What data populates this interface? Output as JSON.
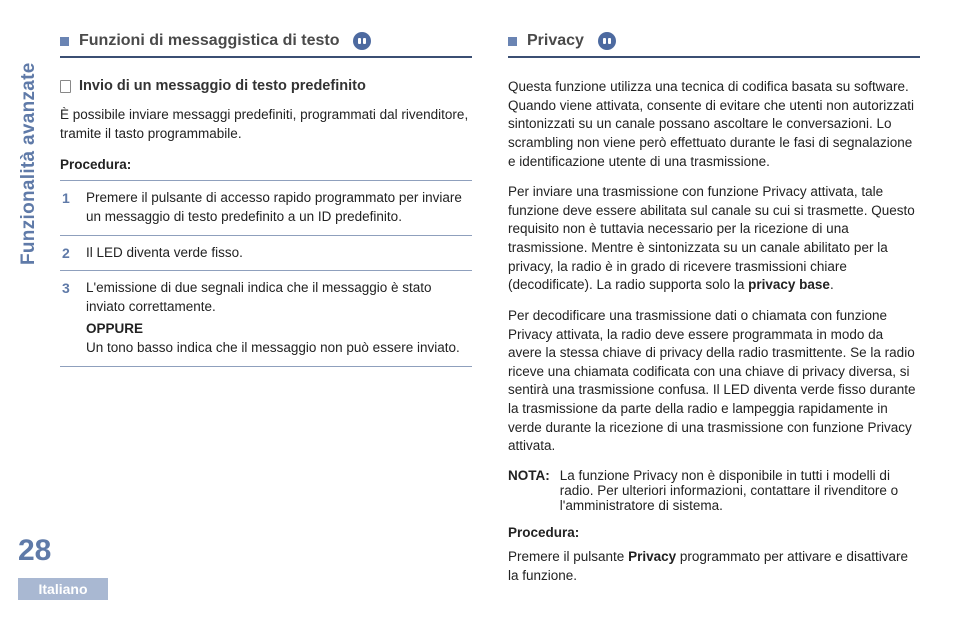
{
  "meta": {
    "side_label": "Funzionalità avanzate",
    "page_number": "28",
    "language": "Italiano"
  },
  "left": {
    "section_title": "Funzioni di messaggistica di testo",
    "sub_title": "Invio di un messaggio di testo predefinito",
    "intro": "È possibile inviare messaggi predefiniti, programmati dal rivenditore, tramite il tasto programmabile.",
    "procedure_label": "Procedura:",
    "steps": {
      "s1": "Premere il pulsante di accesso rapido programmato per inviare un messaggio di testo predefinito a un ID predefinito.",
      "s2": "Il LED diventa verde fisso.",
      "s3a": "L'emissione di due segnali indica che il messaggio è stato inviato correttamente.",
      "s3_or": "OPPURE",
      "s3b": "Un tono basso indica che il messaggio non può essere inviato."
    }
  },
  "right": {
    "section_title": "Privacy",
    "p1a": "Questa funzione utilizza una tecnica di codifica basata su software. Quando viene attivata, consente di evitare che utenti non autorizzati sintonizzati su un canale possano ascoltare le conversazioni. Lo scrambling non viene però effettuato durante le fasi di segnalazione e identificazione utente di una trasmissione.",
    "p2a": "Per inviare una trasmissione con funzione Privacy attivata, tale funzione deve essere abilitata sul canale su cui si trasmette. Questo requisito non è tuttavia necessario per la ricezione di una trasmissione. Mentre è sintonizzata su un canale abilitato per la privacy, la radio è in grado di ricevere trasmissioni chiare (decodificate). La radio supporta solo la ",
    "p2b": "privacy base",
    "p2c": ".",
    "p3": "Per decodificare una trasmissione dati o chiamata con funzione Privacy attivata, la radio deve essere programmata in modo da avere la stessa chiave di privacy della radio trasmittente. Se la radio riceve una chiamata codificata con una chiave di privacy diversa, si sentirà una trasmissione confusa. Il LED diventa verde fisso durante la trasmissione da parte della radio e lampeggia rapidamente in verde durante la ricezione di una trasmissione con funzione Privacy attivata.",
    "note_label": "NOTA:",
    "note_text": "La funzione Privacy non è disponibile in tutti i modelli di radio. Per ulteriori informazioni, contattare il rivenditore o l'amministratore di sistema.",
    "procedure_label": "Procedura:",
    "proc_a": "Premere il pulsante ",
    "proc_b": "Privacy",
    "proc_c": " programmato per attivare e disattivare la funzione."
  }
}
